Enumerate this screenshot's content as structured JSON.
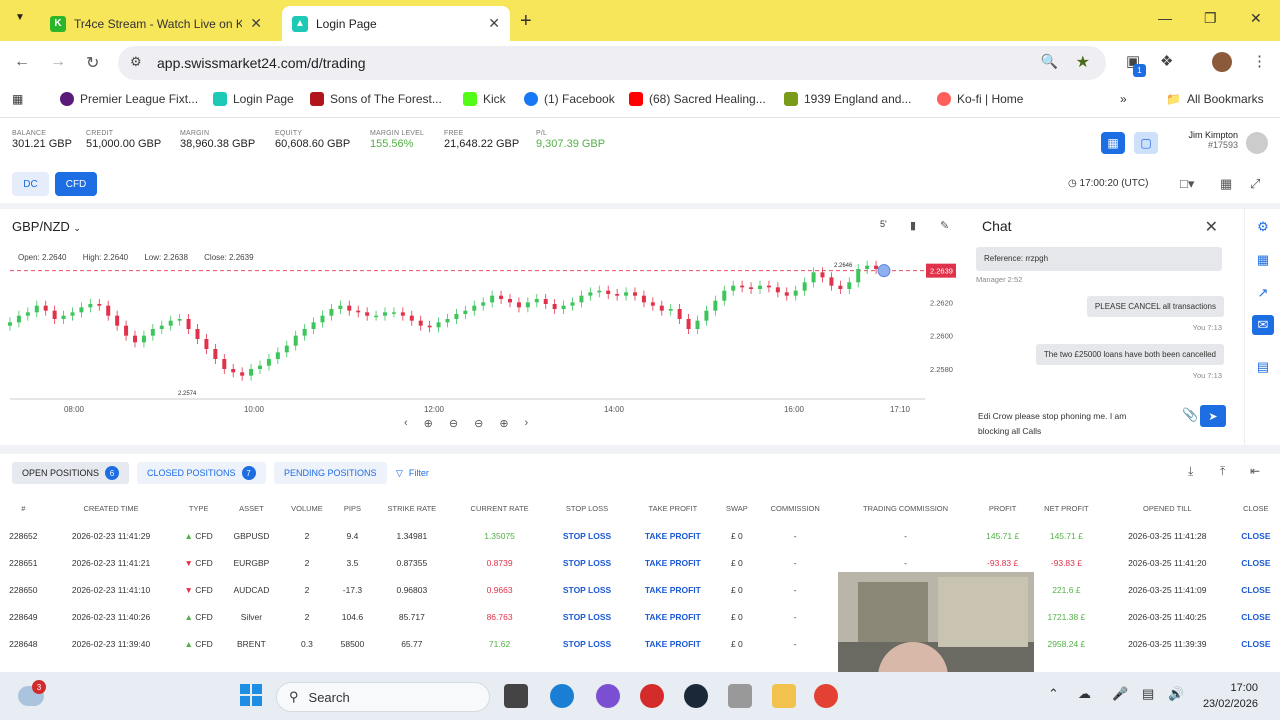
{
  "browser": {
    "tabs": [
      {
        "title": "Tr4ce Stream - Watch Live on K",
        "active": false,
        "favicon_color": "#53fc18"
      },
      {
        "title": "Login Page",
        "active": true,
        "favicon_color": "#1ec9b6"
      }
    ],
    "url": "app.swissmarket24.com/d/trading",
    "bookmarks": [
      {
        "label": "Premier League Fixt...",
        "color": "#5a1a7a"
      },
      {
        "label": "Login Page",
        "color": "#1ec9b6"
      },
      {
        "label": "Sons of The Forest...",
        "color": "#b0151a"
      },
      {
        "label": "Kick",
        "color": "#53fc18"
      },
      {
        "label": "(1) Facebook",
        "color": "#1877f2"
      },
      {
        "label": "(68) Sacred Healing...",
        "color": "#ff0000"
      },
      {
        "label": "1939 England and...",
        "color": "#7a9a1a"
      },
      {
        "label": "Ko-fi | Home",
        "color": "#ff5e5b"
      }
    ],
    "all_bookmarks": "All Bookmarks",
    "ext_badge": "1"
  },
  "account": {
    "stats": [
      {
        "label": "BALANCE",
        "value": "301.21 GBP",
        "green": false
      },
      {
        "label": "CREDIT",
        "value": "51,000.00 GBP",
        "green": false
      },
      {
        "label": "MARGIN",
        "value": "38,960.38 GBP",
        "green": false
      },
      {
        "label": "EQUITY",
        "value": "60,608.60 GBP",
        "green": false
      },
      {
        "label": "MARGIN LEVEL",
        "value": "155.56%",
        "green": true
      },
      {
        "label": "FREE",
        "value": "21,648.22 GBP",
        "green": false
      },
      {
        "label": "P/L",
        "value": "9,307.39 GBP",
        "green": true
      }
    ],
    "user_name": "Jim Kimpton",
    "user_id": "#17593"
  },
  "mode": {
    "dc": "DC",
    "cfd": "CFD",
    "time": "17:00:20 (UTC)"
  },
  "chart": {
    "pair": "GBP/NZD",
    "timeframe": "5'",
    "ohlc": {
      "open": "Open: 2.2640",
      "high": "High: 2.2640",
      "low": "Low: 2.2638",
      "close": "Close: 2.2639"
    },
    "current_price": "2.2639",
    "high_marker": "2.2646",
    "low_marker": "2.2574"
  },
  "chart_data": {
    "type": "line",
    "title": "GBP/NZD",
    "x_ticks": [
      "08:00",
      "10:00",
      "12:00",
      "14:00",
      "16:00",
      "17:10"
    ],
    "y_ticks": [
      "2.2639",
      "2.2620",
      "2.2600",
      "2.2580"
    ],
    "ylim": [
      2.2568,
      2.2652
    ],
    "close_series": [
      2.2608,
      2.2612,
      2.2614,
      2.2618,
      2.2615,
      2.261,
      2.2612,
      2.2614,
      2.2617,
      2.2619,
      2.2618,
      2.2612,
      2.2606,
      2.26,
      2.2596,
      2.26,
      2.2604,
      2.2606,
      2.2609,
      2.261,
      2.2604,
      2.2598,
      2.2592,
      2.2586,
      2.258,
      2.2578,
      2.2576,
      2.258,
      2.2582,
      2.2586,
      2.259,
      2.2594,
      2.26,
      2.2604,
      2.2608,
      2.2612,
      2.2616,
      2.2618,
      2.2615,
      2.2614,
      2.2612,
      2.2612,
      2.2614,
      2.2614,
      2.2612,
      2.2609,
      2.2606,
      2.2605,
      2.2608,
      2.261,
      2.2613,
      2.2615,
      2.2618,
      2.262,
      2.2624,
      2.2622,
      2.262,
      2.2617,
      2.262,
      2.2622,
      2.2619,
      2.2616,
      2.2618,
      2.262,
      2.2624,
      2.2626,
      2.2627,
      2.2625,
      2.2624,
      2.2626,
      2.2624,
      2.262,
      2.2618,
      2.2615,
      2.2616,
      2.261,
      2.2604,
      2.2609,
      2.2615,
      2.2621,
      2.2627,
      2.263,
      2.2629,
      2.2628,
      2.263,
      2.2629,
      2.2626,
      2.2624,
      2.2627,
      2.2632,
      2.2638,
      2.2635,
      2.263,
      2.2628,
      2.2632,
      2.264,
      2.2642,
      2.264,
      2.2639
    ]
  },
  "chat": {
    "title": "Chat",
    "reference": "Reference: rrzpgh",
    "manager_meta": "Manager 2:52",
    "messages": [
      {
        "text": "PLEASE CANCEL all transactions",
        "meta": "You 7:13"
      },
      {
        "text": "The two £25000 loans have both been cancelled",
        "meta": "You 7:13"
      }
    ],
    "input_text": "Edi Crow please stop phoning me. I am blocking all Calls"
  },
  "positions": {
    "tabs": [
      {
        "label": "OPEN POSITIONS",
        "count": "6"
      },
      {
        "label": "CLOSED POSITIONS",
        "count": "7"
      },
      {
        "label": "PENDING POSITIONS",
        "count": ""
      }
    ],
    "filter": "Filter",
    "columns": [
      "#",
      "CREATED TIME",
      "TYPE",
      "ASSET",
      "VOLUME",
      "PIPS",
      "STRIKE RATE",
      "CURRENT RATE",
      "STOP LOSS",
      "TAKE PROFIT",
      "SWAP",
      "COMMISSION",
      "TRADING COMMISSION",
      "PROFIT",
      "NET PROFIT",
      "OPENED TILL",
      "CLOSE"
    ],
    "rows": [
      {
        "id": "228652",
        "created": "2026-02-23 11:41:29",
        "dir": "up",
        "type": "CFD",
        "asset": "GBPUSD",
        "volume": "2",
        "pips": "9.4",
        "strike": "1.34981",
        "current": "1.35075",
        "cur_color": "g",
        "sl": "STOP LOSS",
        "tp": "TAKE PROFIT",
        "swap": "£ 0",
        "commission": "-",
        "trading_commission": "-",
        "profit": "145.71 £",
        "profit_color": "g",
        "net": "145.71 £",
        "net_color": "g",
        "till": "2026-03-25 11:41:28",
        "close": "CLOSE"
      },
      {
        "id": "228651",
        "created": "2026-02-23 11:41:21",
        "dir": "down",
        "type": "CFD",
        "asset": "EURGBP",
        "volume": "2",
        "pips": "3.5",
        "strike": "0.87355",
        "current": "0.8739",
        "cur_color": "r",
        "sl": "STOP LOSS",
        "tp": "TAKE PROFIT",
        "swap": "£ 0",
        "commission": "-",
        "trading_commission": "-",
        "profit": "-93.83 £",
        "profit_color": "r",
        "net": "-93.83 £",
        "net_color": "r",
        "till": "2026-03-25 11:41:20",
        "close": "CLOSE"
      },
      {
        "id": "228650",
        "created": "2026-02-23 11:41:10",
        "dir": "down",
        "type": "CFD",
        "asset": "AUDCAD",
        "volume": "2",
        "pips": "-17.3",
        "strike": "0.96803",
        "current": "0.9663",
        "cur_color": "r",
        "sl": "STOP LOSS",
        "tp": "TAKE PROFIT",
        "swap": "£ 0",
        "commission": "-",
        "trading_commission": "-",
        "profit": "",
        "profit_color": "g",
        "net": "221.6 £",
        "net_color": "g",
        "till": "2026-03-25 11:41:09",
        "close": "CLOSE"
      },
      {
        "id": "228649",
        "created": "2026-02-23 11:40:26",
        "dir": "up",
        "type": "CFD",
        "asset": "Silver",
        "volume": "2",
        "pips": "104.6",
        "strike": "85.717",
        "current": "86.763",
        "cur_color": "r",
        "sl": "STOP LOSS",
        "tp": "TAKE PROFIT",
        "swap": "£ 0",
        "commission": "-",
        "trading_commission": "-",
        "profit": "",
        "profit_color": "g",
        "net": "1721.38 £",
        "net_color": "g",
        "till": "2026-03-25 11:40:25",
        "close": "CLOSE"
      },
      {
        "id": "228648",
        "created": "2026-02-23 11:39:40",
        "dir": "up",
        "type": "CFD",
        "asset": "BRENT",
        "volume": "0.3",
        "pips": "58500",
        "strike": "65.77",
        "current": "71.62",
        "cur_color": "g",
        "sl": "STOP LOSS",
        "tp": "TAKE PROFIT",
        "swap": "£ 0",
        "commission": "-",
        "trading_commission": "-",
        "profit": "",
        "profit_color": "g",
        "net": "2958.24 £",
        "net_color": "g",
        "till": "2026-03-25 11:39:39",
        "close": "CLOSE"
      }
    ]
  },
  "taskbar": {
    "search": "Search",
    "weather_badge": "3",
    "time": "17:00",
    "date": "23/02/2026"
  }
}
